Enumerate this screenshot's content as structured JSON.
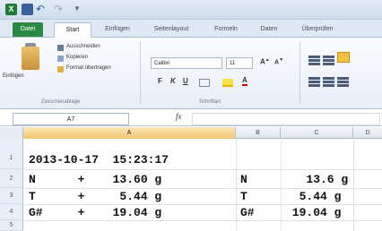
{
  "titlebar": {
    "app_icon": "excel-icon",
    "save_icon": "save-icon",
    "undo_icon": "undo-icon",
    "redo_icon": "redo-icon"
  },
  "tabs": [
    "Datei",
    "Start",
    "Einfügen",
    "Seitenlayout",
    "Formeln",
    "Daten",
    "Überprüfen"
  ],
  "clipboard": {
    "paste_label": "Einfügen",
    "cut_label": "Ausschneiden",
    "copy_label": "Kopieren",
    "format_painter_label": "Format übertragen",
    "group_label": "Zwischenablage"
  },
  "font": {
    "name": "Calibri",
    "size": "11",
    "group_label": "Schriftart"
  },
  "formula_bar": {
    "name_box": "A7",
    "fx": "fx",
    "value": ""
  },
  "columns": [
    "A",
    "B",
    "C",
    "D"
  ],
  "rows": [
    {
      "num": "1",
      "A": "2013-10-17  15:23:17",
      "B": "",
      "C": ""
    },
    {
      "num": "2",
      "A": "N      +    13.60 g",
      "B": "N",
      "C": "   13.6 g"
    },
    {
      "num": "3",
      "A": "T      +     5.44 g",
      "B": "T",
      "C": "  5.44 g"
    },
    {
      "num": "4",
      "A": "G#     +    19.04 g",
      "B": "G#",
      "C": " 19.04 g"
    },
    {
      "num": "5",
      "A": "",
      "B": "",
      "C": ""
    }
  ],
  "colors": {
    "datei_tab": "#2a8a43",
    "selected_col": "#f2c56c"
  }
}
